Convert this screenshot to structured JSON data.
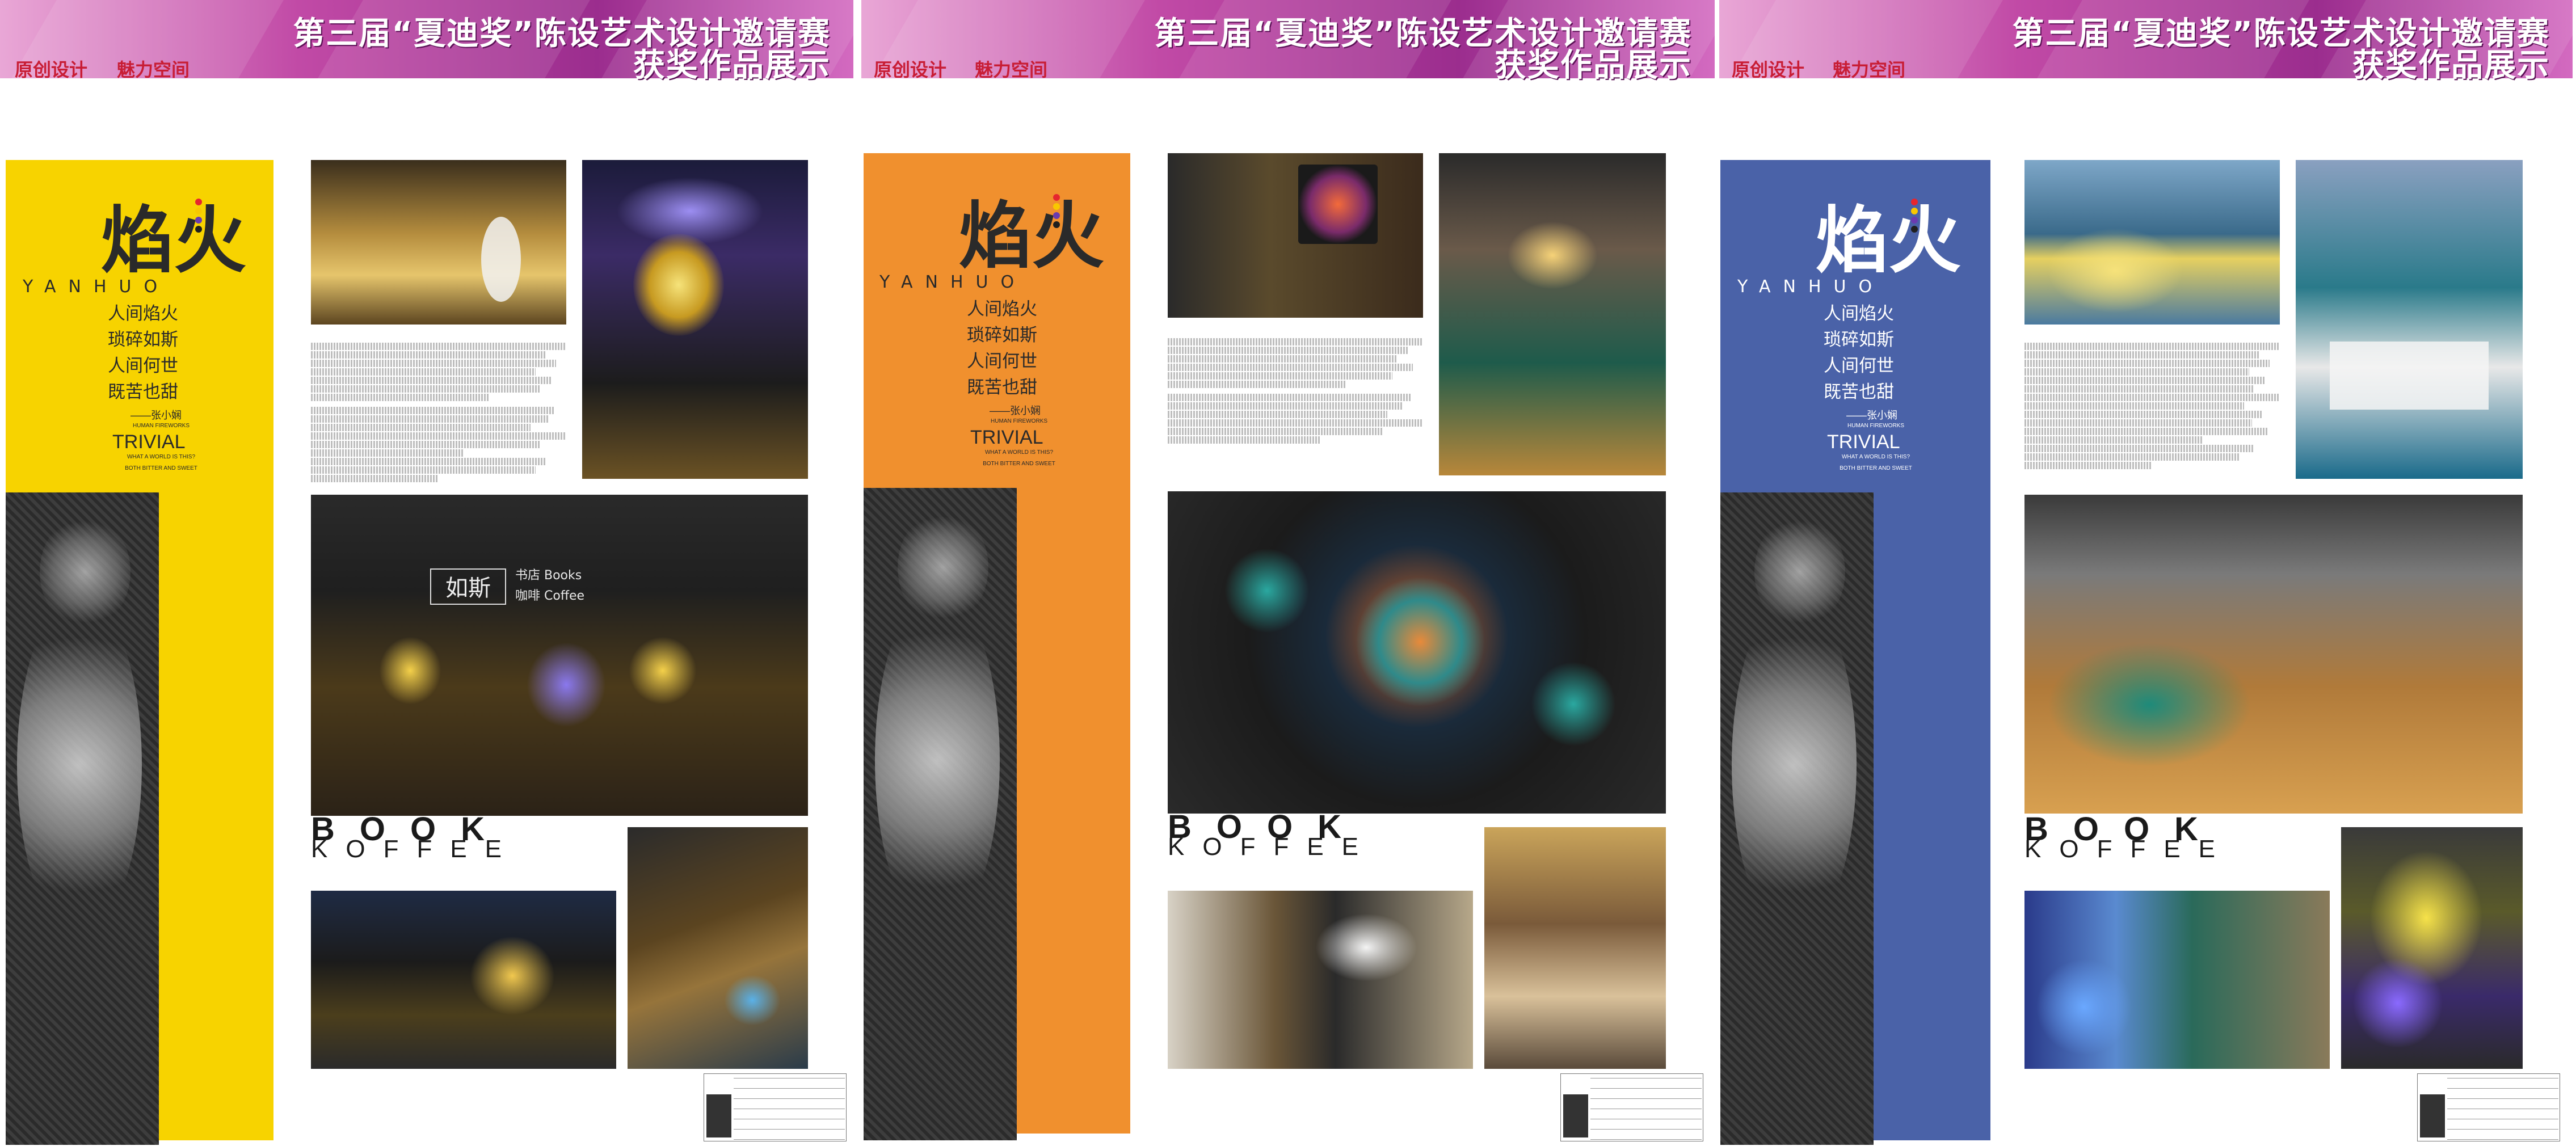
{
  "banner": {
    "line1": "第三届“夏迪奖”陈设艺术设计邀请赛",
    "line2": "获奖作品展示",
    "subtitle_left": "原创设计",
    "subtitle_right": "魅力空间"
  },
  "poster": {
    "title_char": "焰火",
    "pen_word": "YANHUO",
    "poem": [
      "人间焰火",
      "琐碎如斯",
      "人间何世",
      "既苦也甜"
    ],
    "signature": "——张小娴",
    "en_line1": "HUMAN FIREWORKS",
    "trivial": "TRIVIAL",
    "en_line2": "WHAT A WORLD IS THIS?",
    "en_line3": "BOTH BITTER AND SWEET",
    "book": "BOOK",
    "koffee": "KOFFEE",
    "sign_books": "书店 Books",
    "sign_coffee": "咖啡 Coffee",
    "sign_logo": "如斯"
  },
  "colors": {
    "banner": "#b23a9a",
    "subtitle": "#c81d35",
    "panel1": "#f7d300",
    "panel2": "#f0902e",
    "panel3": "#4a62a8"
  },
  "icons": [
    "color-dots-icon"
  ]
}
